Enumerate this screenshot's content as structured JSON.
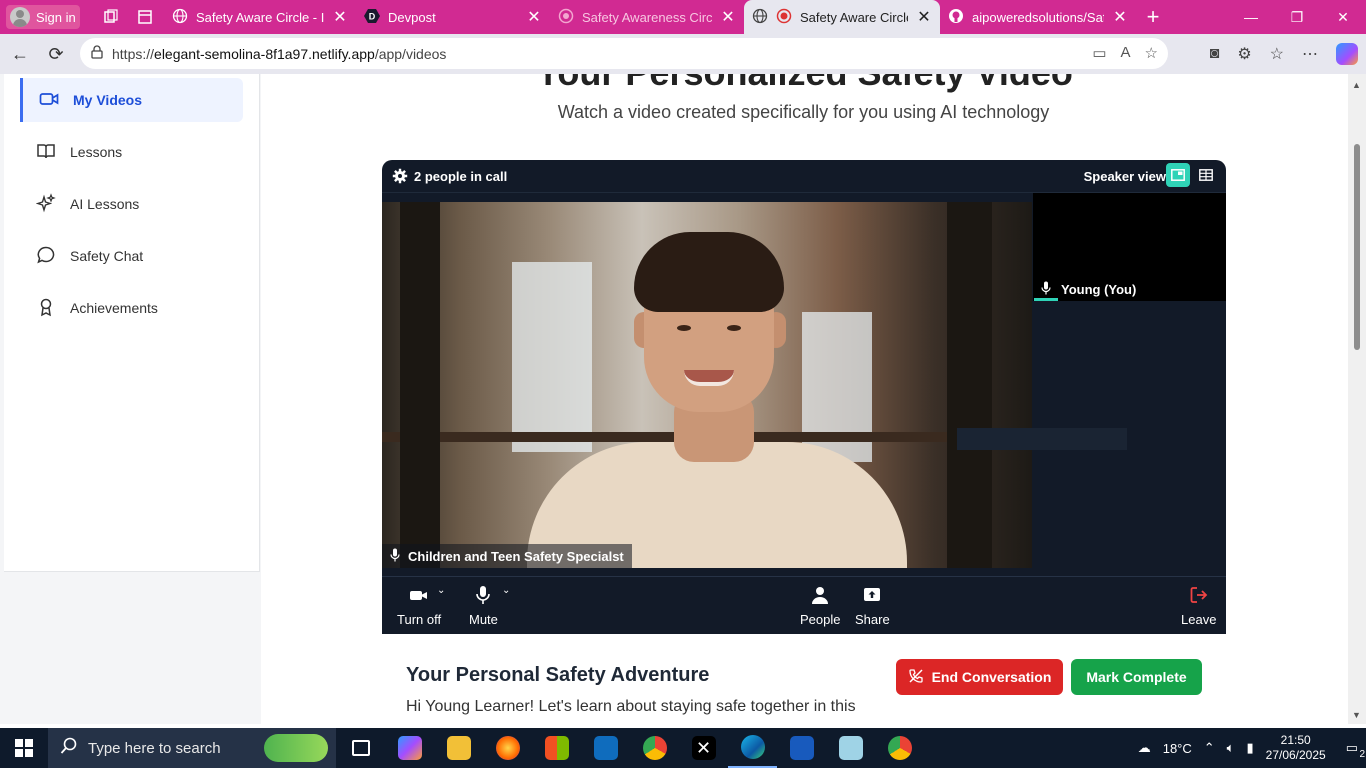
{
  "browser": {
    "signin_label": "Sign in",
    "tabs": [
      {
        "title": "Safety Aware Circle - Inte",
        "icon": "globe-icon"
      },
      {
        "title": "Devpost",
        "icon": "devpost-icon"
      },
      {
        "title": "Safety Awareness Circle D",
        "icon": "circle-icon"
      },
      {
        "title": "Safety Aware Circle -",
        "icon": "globe-icon",
        "active": true
      },
      {
        "title": "aipoweredsolutions/Safet",
        "icon": "github-icon"
      }
    ],
    "url_prefix": "https://",
    "url_host": "elegant-semolina-8f1a97.netlify.app",
    "url_path": "/app/videos"
  },
  "sidebar": {
    "items": [
      {
        "label": "My Videos",
        "icon": "video-camera-icon",
        "active": true
      },
      {
        "label": "Lessons",
        "icon": "book-icon"
      },
      {
        "label": "AI Lessons",
        "icon": "sparkles-icon"
      },
      {
        "label": "Safety Chat",
        "icon": "chat-bubble-icon"
      },
      {
        "label": "Achievements",
        "icon": "award-icon"
      }
    ]
  },
  "main": {
    "title": "Your Personalized Safety Video",
    "subtitle": "Watch a video created specifically for you using AI technology"
  },
  "call": {
    "people_count": "2 people in call",
    "speaker_view": "Speaker view",
    "main_participant": "Children and Teen Safety Specialst",
    "self_participant": "Young (You)",
    "controls": {
      "turn_off": "Turn off",
      "mute": "Mute",
      "people": "People",
      "share": "Share",
      "leave": "Leave"
    }
  },
  "adventure": {
    "title": "Your Personal Safety Adventure",
    "text": "Hi Young Learner! Let's learn about staying safe together in this",
    "end_button": "End Conversation",
    "complete_button": "Mark Complete"
  },
  "taskbar": {
    "search_placeholder": "Type here to search",
    "weather": "18°C",
    "time": "21:50",
    "date": "27/06/2025",
    "notification_count": "2"
  },
  "colors": {
    "tabbar": "#d12a92",
    "accent_blue": "#1d4ed8",
    "call_bg": "#121a28",
    "end_red": "#dc2626",
    "complete_green": "#16a34a",
    "teal": "#2fd3b7"
  }
}
